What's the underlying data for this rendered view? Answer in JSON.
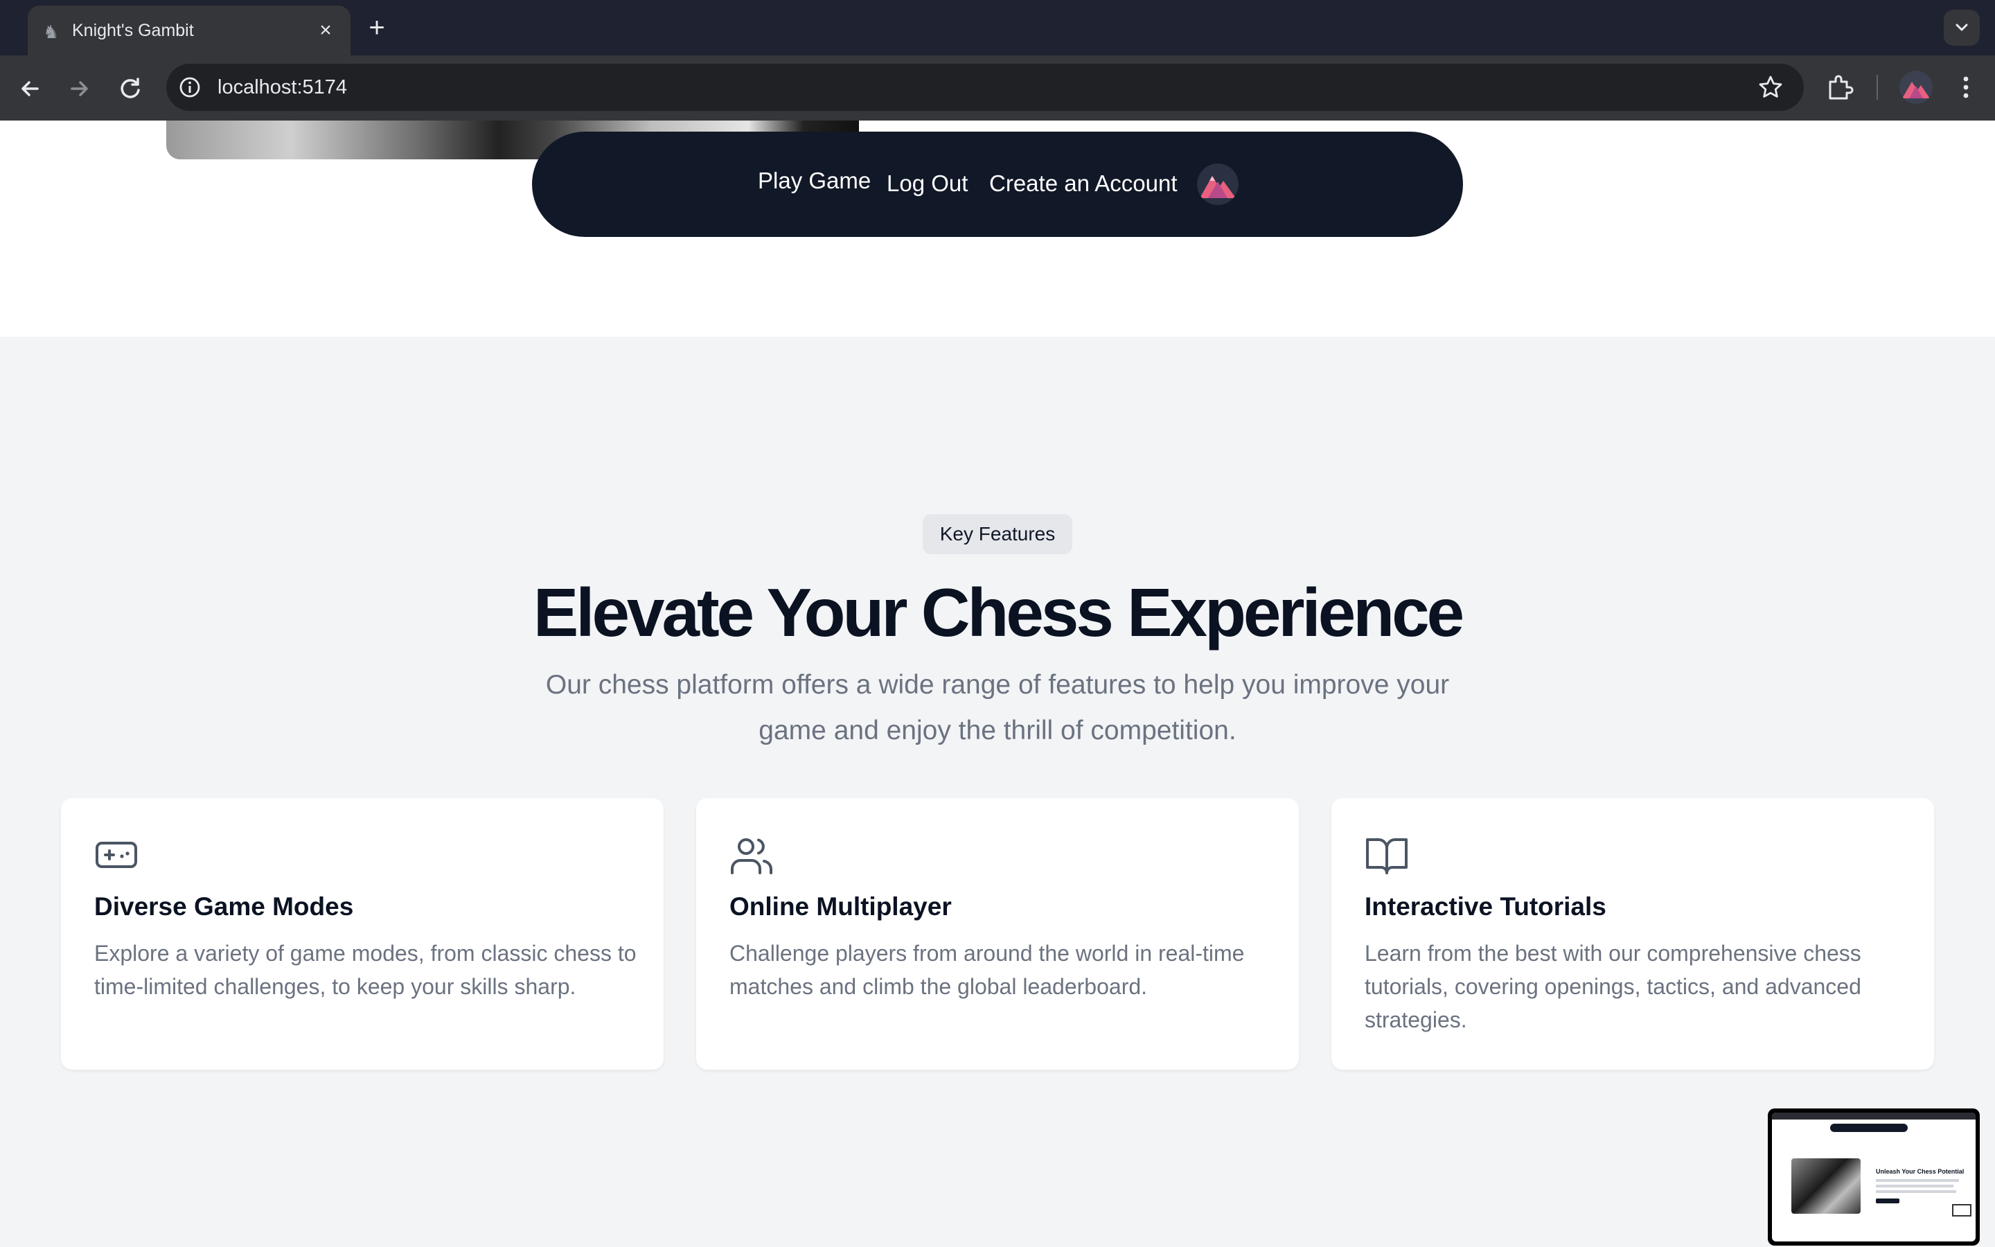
{
  "browser": {
    "tab_title": "Knight's Gambit",
    "tab_close": "×",
    "new_tab": "+",
    "url": "localhost:5174"
  },
  "nav": {
    "play_game": "Play Game",
    "log_out": "Log Out",
    "create_account": "Create an Account"
  },
  "features": {
    "badge": "Key Features",
    "heading": "Elevate Your Chess Experience",
    "subtitle": "Our chess platform offers a wide range of features to help you improve your game and enjoy the thrill of competition.",
    "cards": [
      {
        "icon": "gamepad-icon",
        "title": "Diverse Game Modes",
        "text": "Explore a variety of game modes, from classic chess to time-limited challenges, to keep your skills sharp."
      },
      {
        "icon": "users-icon",
        "title": "Online Multiplayer",
        "text": "Challenge players from around the world in real-time matches and climb the global leaderboard."
      },
      {
        "icon": "book-open-icon",
        "title": "Interactive Tutorials",
        "text": "Learn from the best with our comprehensive chess tutorials, covering openings, tactics, and advanced strategies."
      }
    ]
  },
  "pip_preview": {
    "heading": "Unleash Your Chess Potential"
  },
  "colors": {
    "nav_bg": "#111827",
    "heading": "#0b1222",
    "muted_text": "#6b7280",
    "section_bg": "#f3f4f6"
  }
}
